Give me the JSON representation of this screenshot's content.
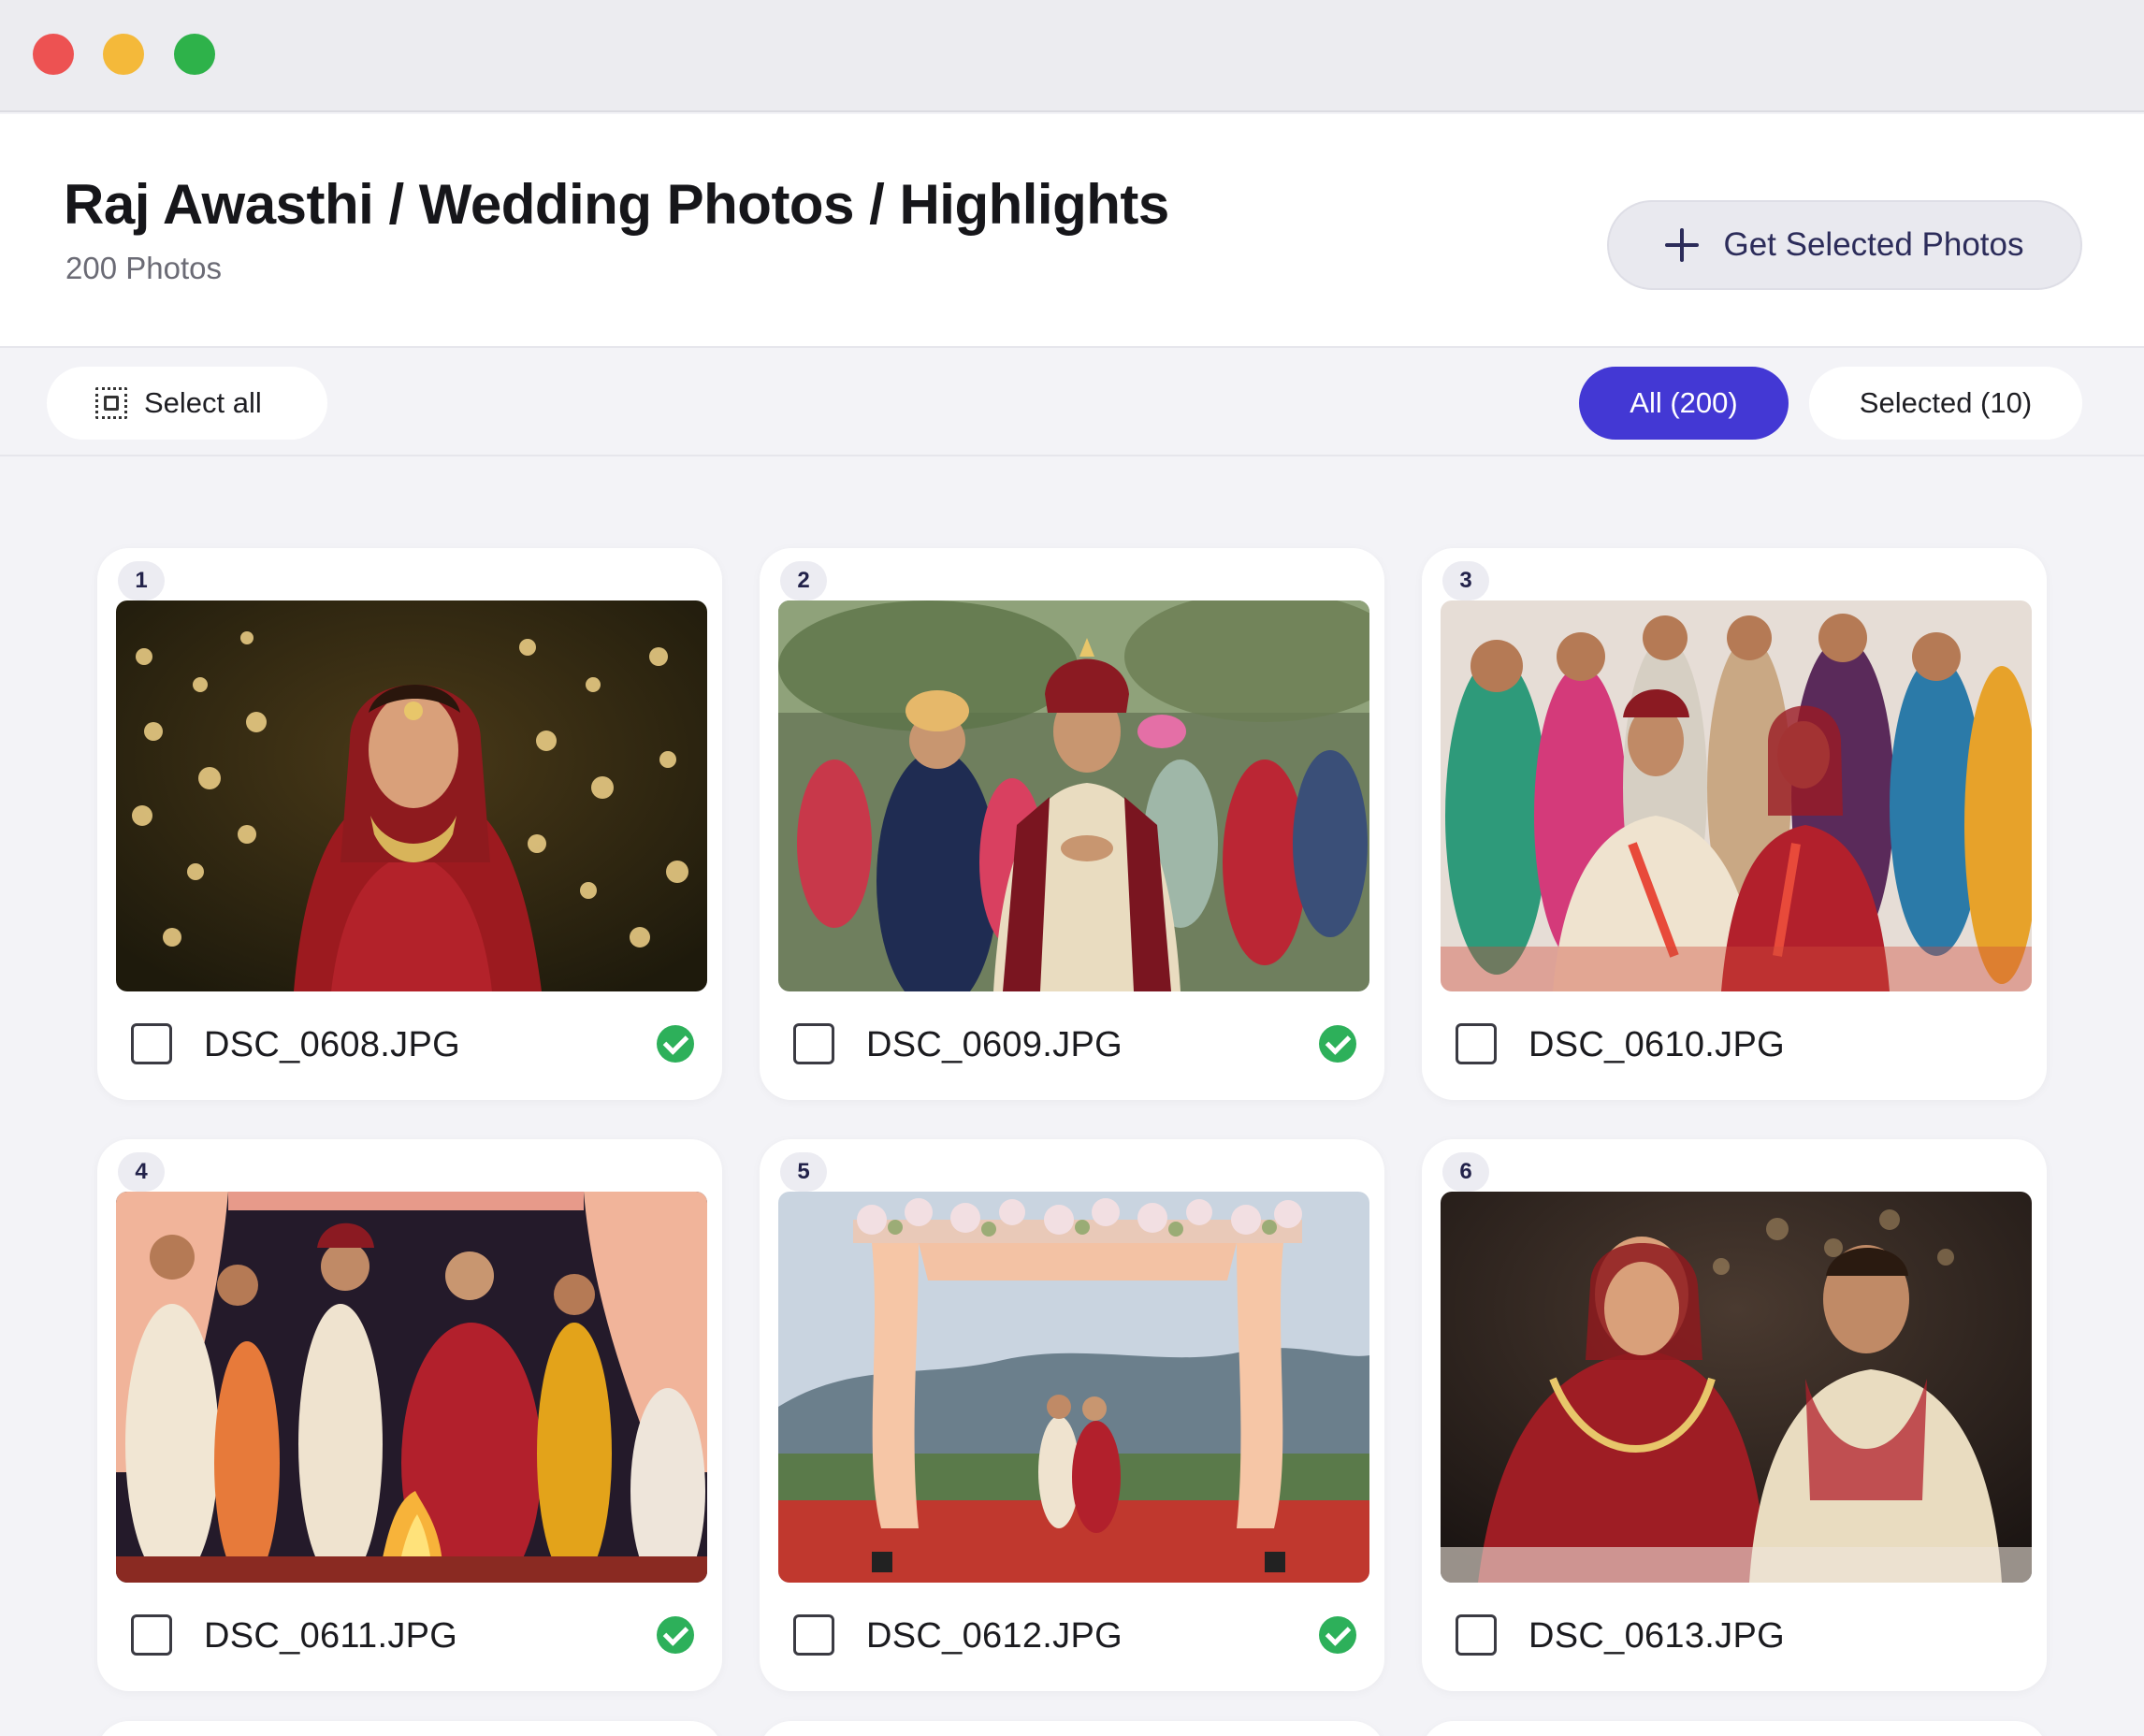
{
  "window": {
    "controls": [
      "close",
      "minimize",
      "maximize"
    ]
  },
  "header": {
    "breadcrumb": "Raj Awasthi / Wedding Photos / Highlights",
    "photo_count": "200 Photos",
    "get_selected_label": "Get Selected Photos",
    "get_selected_icon": "plus-icon"
  },
  "toolbar": {
    "select_all_label": "Select all",
    "select_all_icon": "select-all-icon",
    "tabs": [
      {
        "label": "All (200)",
        "active": true
      },
      {
        "label": "Selected (10)",
        "active": false
      }
    ]
  },
  "colors": {
    "accent": "#4338d4",
    "selected_check": "#2db05a"
  },
  "photos": [
    {
      "number": "1",
      "filename": "DSC_0608.JPG",
      "checked": false,
      "verified": true,
      "subject": "bride-portrait"
    },
    {
      "number": "2",
      "filename": "DSC_0609.JPG",
      "checked": false,
      "verified": true,
      "subject": "groom-procession"
    },
    {
      "number": "3",
      "filename": "DSC_0610.JPG",
      "checked": false,
      "verified": false,
      "subject": "couple-with-family"
    },
    {
      "number": "4",
      "filename": "DSC_0611.JPG",
      "checked": false,
      "verified": true,
      "subject": "fire-ceremony"
    },
    {
      "number": "5",
      "filename": "DSC_0612.JPG",
      "checked": false,
      "verified": true,
      "subject": "mandap-outdoor"
    },
    {
      "number": "6",
      "filename": "DSC_0613.JPG",
      "checked": false,
      "verified": false,
      "subject": "couple-laughing"
    }
  ]
}
